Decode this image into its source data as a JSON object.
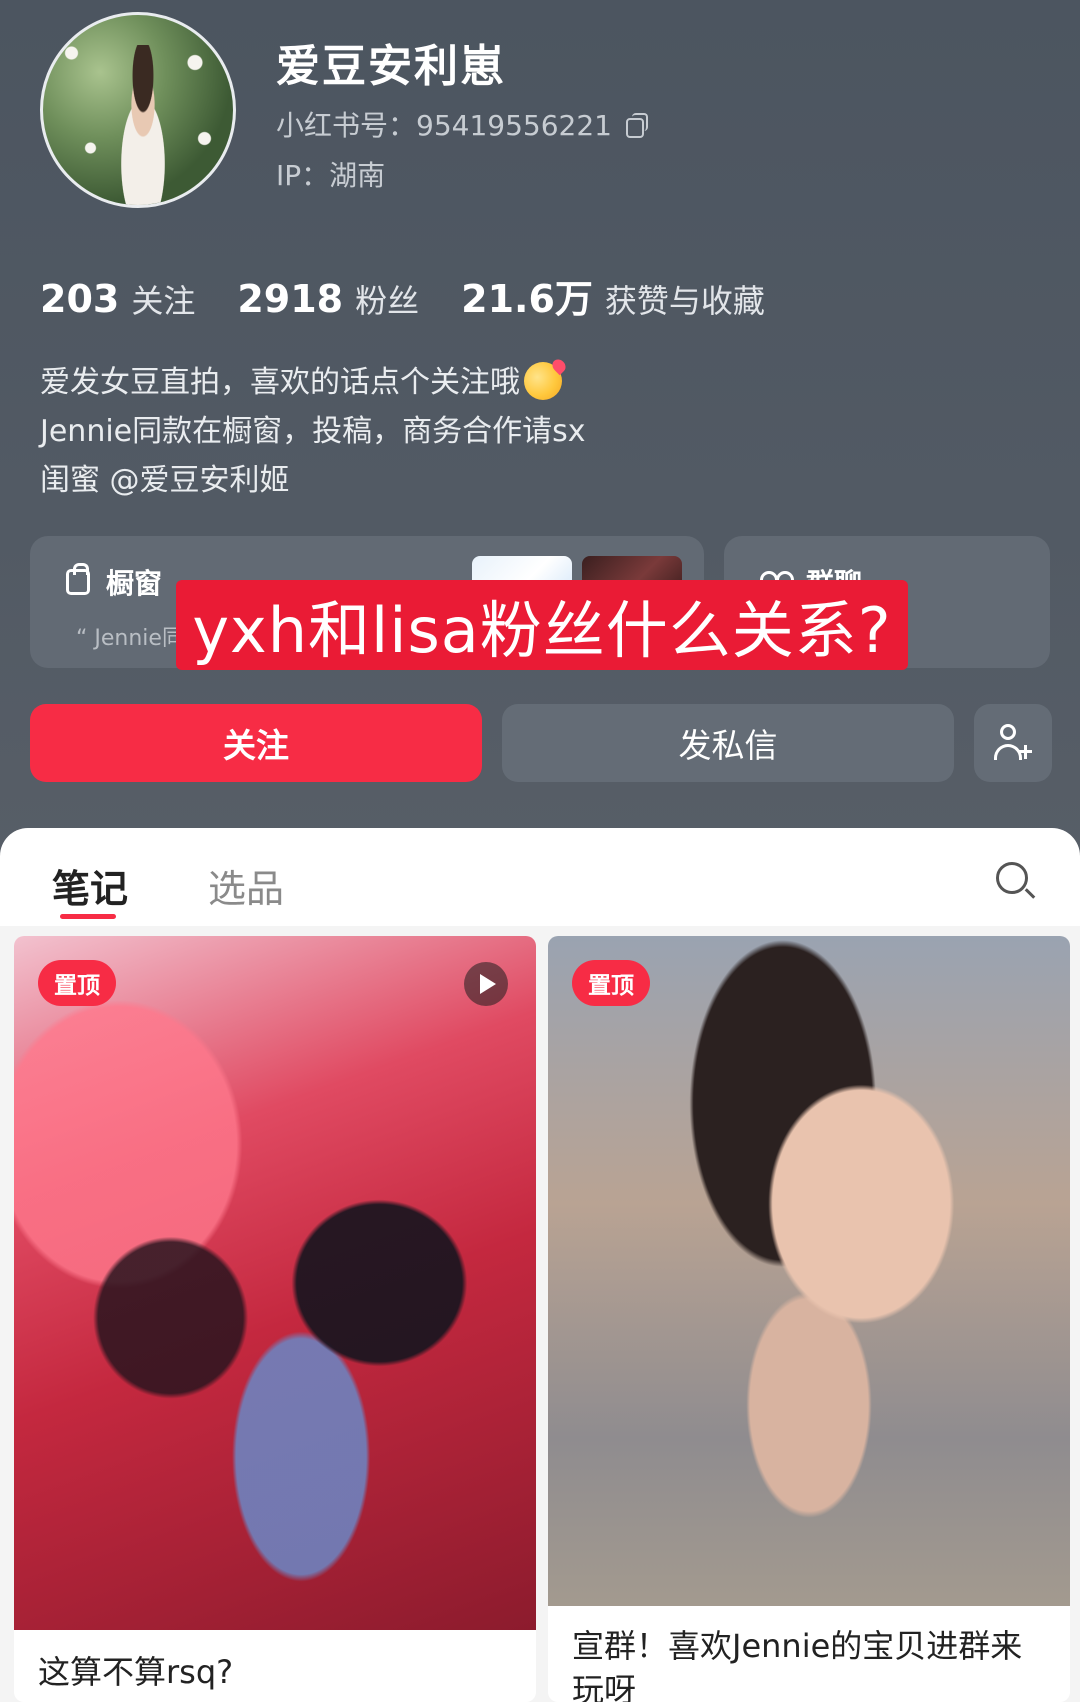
{
  "profile": {
    "name": "爱豆安利崽",
    "id_text": "小红书号：95419556221",
    "ip_text": "IP：湖南"
  },
  "stats": [
    {
      "num": "203",
      "label": "关注"
    },
    {
      "num": "2918",
      "label": "粉丝"
    },
    {
      "num": "21.6万",
      "label": "获赞与收藏"
    }
  ],
  "bio": {
    "line1": "爱发女豆直拍，喜欢的话点个关注哦",
    "line2": "Jennie同款在橱窗，投稿，商务合作请sx",
    "line3": "闺蜜 @爱豆安利姬"
  },
  "cards": {
    "shop_title": "橱窗",
    "shop_sub": "“ Jennie同",
    "group_title": "群聊"
  },
  "overlay_caption": "yxh和lisa粉丝什么关系?",
  "buttons": {
    "follow": "关注",
    "message": "发私信"
  },
  "tabs": {
    "notes": "笔记",
    "picks": "选品"
  },
  "notes": [
    {
      "badge": "置顶",
      "title": "这算不算rsq?"
    },
    {
      "badge": "置顶",
      "title": "宣群！喜欢Jennie的宝贝进群来玩呀"
    }
  ],
  "colors": {
    "accent": "#f72c45",
    "header_bg": "#525a64",
    "caption_bg": "#ea1b35"
  }
}
